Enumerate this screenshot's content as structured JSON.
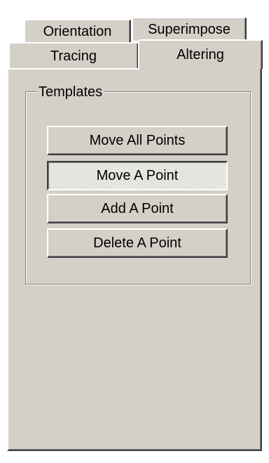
{
  "tabs": {
    "orientation": "Orientation",
    "superimpose": "Superimpose",
    "tracing": "Tracing",
    "altering": "Altering"
  },
  "selected_tab": "Altering",
  "group": {
    "title": "Templates",
    "buttons": [
      {
        "label": "Move All Points",
        "pressed": false
      },
      {
        "label": "Move A Point",
        "pressed": true
      },
      {
        "label": "Add A Point",
        "pressed": false
      },
      {
        "label": "Delete A Point",
        "pressed": false
      }
    ]
  },
  "colors": {
    "face": "#d4d0c8",
    "highlight": "#ffffff",
    "shadow": "#808080",
    "dark_shadow": "#404040"
  }
}
